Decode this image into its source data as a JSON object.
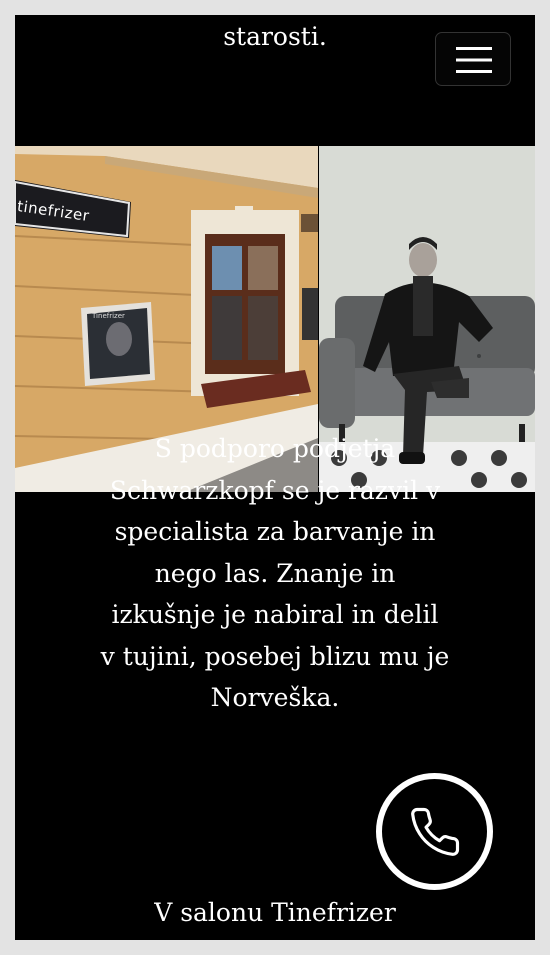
{
  "header": {
    "top_text": "starosti.",
    "menu_icon": "hamburger-menu-icon"
  },
  "photos": {
    "left": {
      "sign_text": "tinefrizer",
      "poster_text": "Tinefrizer"
    },
    "right": {}
  },
  "content": {
    "paragraph_1": "S podporo podjetja\nSchwarzkopf se je razvil v\nspecialista za barvanje in\nnego las. Znanje in\nizkušnje je nabiral in delil\nv tujini, posebej blizu mu je\nNorveška.",
    "paragraph_2": "V salonu Tinefrizer"
  },
  "call_button": {
    "icon": "phone-icon",
    "color": "#ffffff"
  }
}
